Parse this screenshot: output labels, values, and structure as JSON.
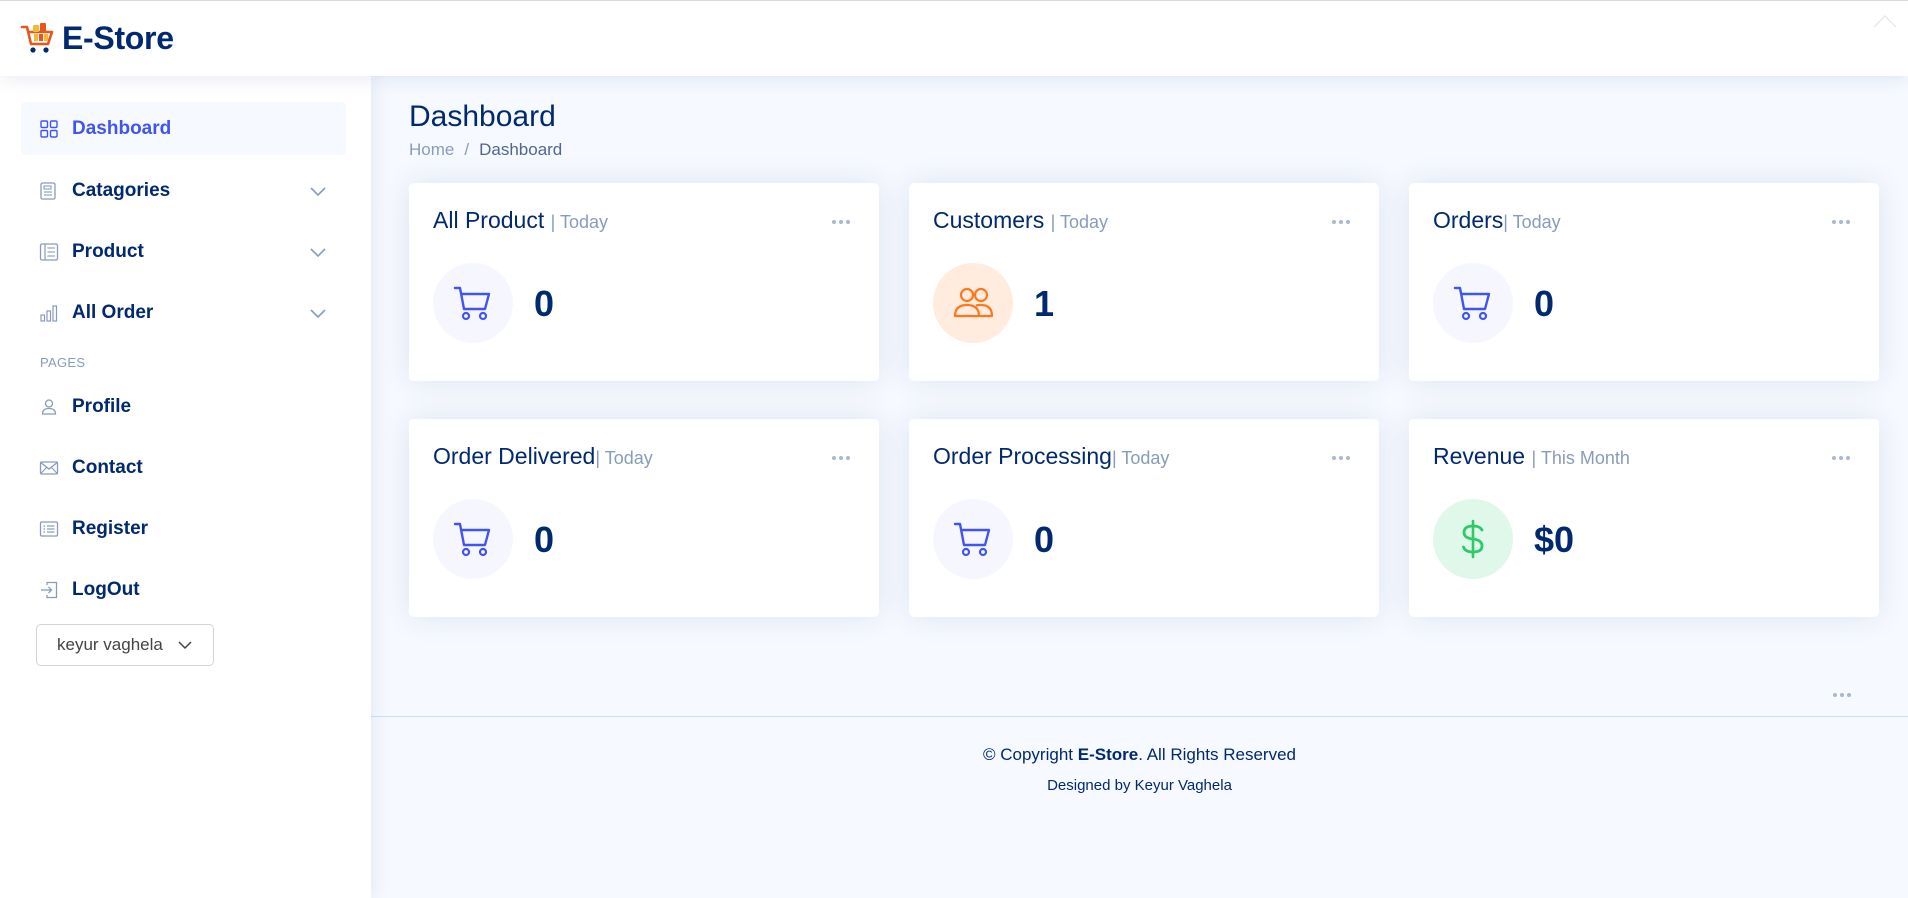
{
  "header": {
    "brand": "E-Store"
  },
  "sidebar": {
    "items": [
      {
        "label": "Dashboard",
        "icon": "grid-icon",
        "active": true
      },
      {
        "label": "Catagories",
        "icon": "menu-button-icon",
        "has_chevron": true
      },
      {
        "label": "Product",
        "icon": "layout-text-sidebar-icon",
        "has_chevron": true
      },
      {
        "label": "All Order",
        "icon": "bar-chart-icon",
        "has_chevron": true
      }
    ],
    "pages_heading": "PAGES",
    "pages": [
      {
        "label": "Profile",
        "icon": "person-icon"
      },
      {
        "label": "Contact",
        "icon": "envelope-icon"
      },
      {
        "label": "Register",
        "icon": "card-list-icon"
      },
      {
        "label": "LogOut",
        "icon": "box-arrow-in-right-icon"
      }
    ],
    "user_select": {
      "value": "keyur vaghela"
    }
  },
  "main": {
    "title": "Dashboard",
    "breadcrumb": {
      "home": "Home",
      "separator": "/",
      "current": "Dashboard"
    },
    "cards": [
      {
        "title": "All Product",
        "period": "| Today",
        "value": "0",
        "icon": "cart-icon",
        "color": "#4154f1"
      },
      {
        "title": "Customers",
        "period": "| Today",
        "value": "1",
        "icon": "people-icon",
        "color": "#ff771d"
      },
      {
        "title": "Orders",
        "period": "| Today",
        "value": "0",
        "icon": "cart-icon",
        "color": "#4154f1"
      },
      {
        "title": "Order Delivered",
        "period": "| Today",
        "value": "0",
        "icon": "cart-icon",
        "color": "#4154f1"
      },
      {
        "title": "Order Processing",
        "period": "| Today",
        "value": "0",
        "icon": "cart-icon",
        "color": "#4154f1"
      },
      {
        "title": "Revenue",
        "period": "| This Month",
        "value": "$0",
        "icon": "currency-dollar-icon",
        "color": "#2eca6a"
      }
    ]
  },
  "footer": {
    "copyright_prefix": "© Copyright ",
    "brand": "E-Store",
    "copyright_suffix": ". All Rights Reserved",
    "credit": "Designed by Keyur Vaghela"
  }
}
